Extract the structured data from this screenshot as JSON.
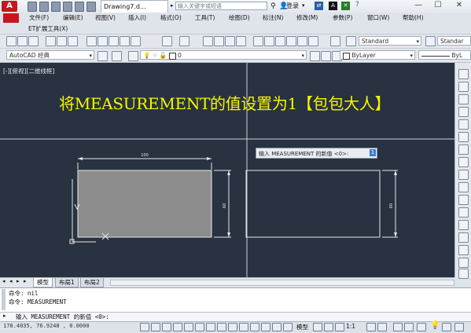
{
  "titlebar": {
    "doc_tab": "Drawing7.d...",
    "search_placeholder": "输入关键字或短语",
    "login": "登录",
    "minimize": "—",
    "maximize": "☐",
    "close": "✕",
    "help_icon": "?"
  },
  "menu": {
    "items": [
      "文件(F)",
      "编辑(E)",
      "视图(V)",
      "插入(I)",
      "格式(O)",
      "工具(T)",
      "绘图(D)",
      "标注(N)",
      "修改(M)",
      "参数(P)",
      "窗口(W)",
      "帮助(H)"
    ],
    "ext_tools": "ET扩展工具(X)"
  },
  "toolbar": {
    "text_style": "Standard",
    "dim_style": "Standar",
    "workspace": "AutoCAD 经典",
    "layer": "0",
    "color": "ByLayer",
    "linetype": "ByL"
  },
  "viewport": {
    "label": "[-][俯视][二维线框]",
    "caption": "将MEASUREMENT的值设置为1【包包大人】",
    "dim_top": "100",
    "dim_left": "60",
    "dim_right": "60",
    "prompt_text": "输入 MEASUREMENT 的新值 <0>:",
    "prompt_value": "1"
  },
  "tabs": [
    "模型",
    "布局1",
    "布局2"
  ],
  "command": {
    "history": [
      "命令: nil",
      "命令: MEASUREMENT"
    ],
    "current": "输入 MEASUREMENT 的新值 <0>:"
  },
  "status": {
    "coords": "178.4035, 76.9248 , 0.0000",
    "model": "模型",
    "scale": "1:1"
  },
  "colors": {
    "canvas": "#283240",
    "caption": "#f7f700",
    "accent": "#c8161e"
  }
}
